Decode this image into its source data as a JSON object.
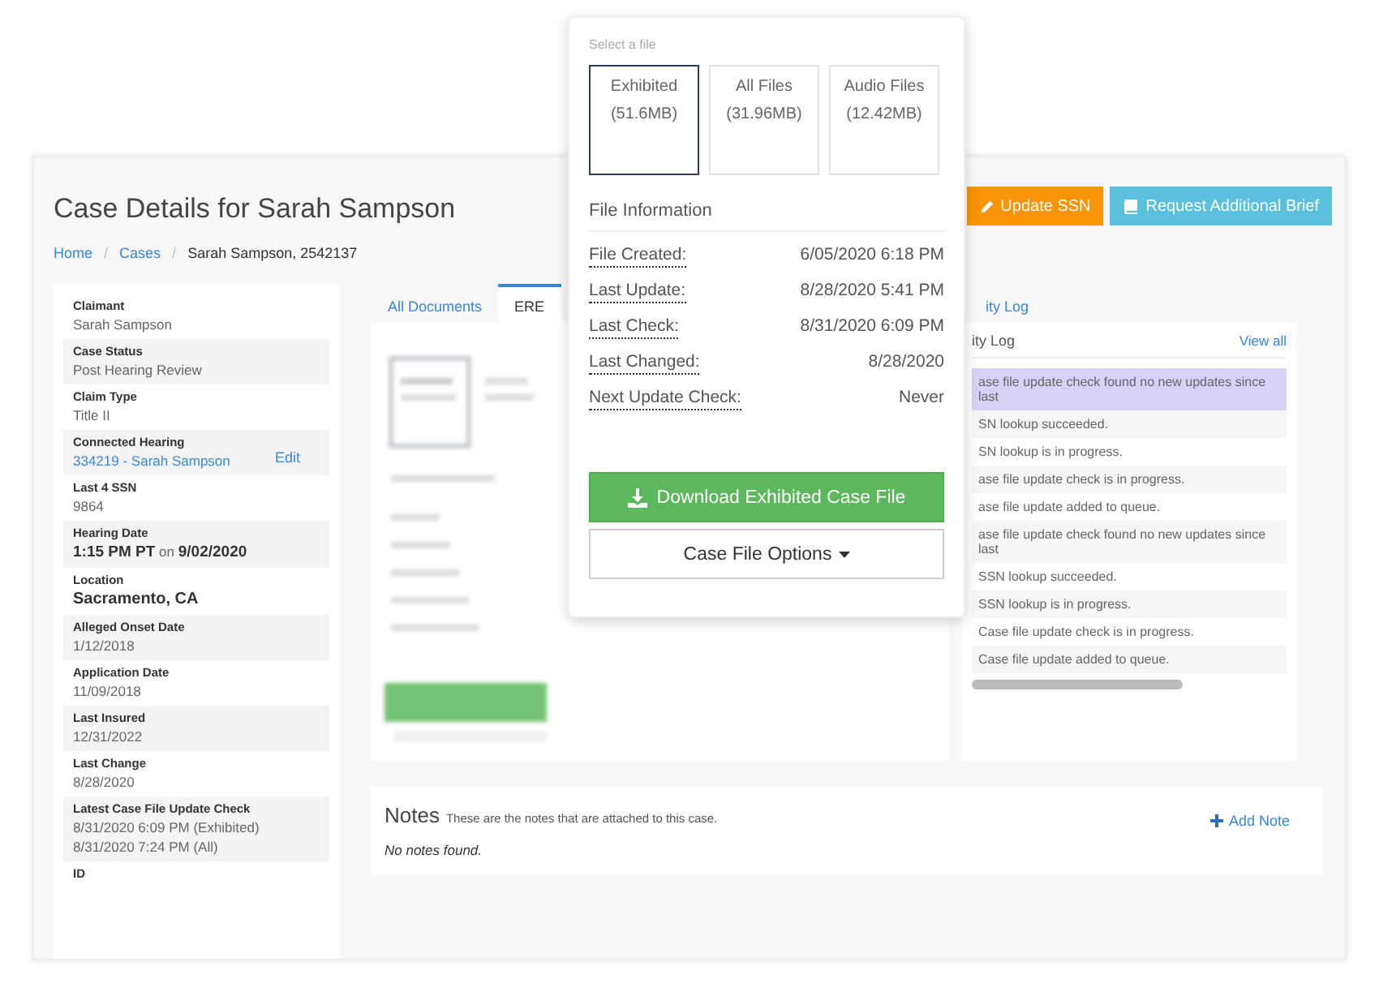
{
  "page": {
    "title": "Case Details for Sarah Sampson",
    "breadcrumb_separators": [
      "/",
      "/"
    ],
    "breadcrumbs": [
      {
        "label": "Home",
        "link": true
      },
      {
        "label": "Cases",
        "link": true
      },
      {
        "label": "Sarah Sampson, 2542137",
        "link": false
      }
    ],
    "actions": [
      {
        "label": "Update SSN",
        "kind": "warning"
      },
      {
        "label": "Request Additional Brief",
        "kind": "info"
      }
    ]
  },
  "details": [
    {
      "label": "Claimant",
      "kind": "plain",
      "values": [
        "Sarah Sampson"
      ]
    },
    {
      "label": "Case Status",
      "kind": "plain",
      "values": [
        "Post Hearing Review"
      ]
    },
    {
      "label": "Claim Type",
      "kind": "plain",
      "values": [
        "Title II"
      ]
    },
    {
      "label": "Connected Hearing",
      "kind": "link",
      "values": [
        "334219 - Sarah Sampson"
      ],
      "action": "Edit"
    },
    {
      "label": "Last 4 SSN",
      "kind": "plain",
      "values": [
        "9864"
      ]
    },
    {
      "label": "Hearing Date",
      "kind": "rich",
      "values": [
        "**1:15 PM PT** on **9/02/2020**"
      ]
    },
    {
      "label": "Location",
      "kind": "bold",
      "values": [
        "Sacramento, CA"
      ]
    },
    {
      "label": "Alleged Onset Date",
      "kind": "plain",
      "values": [
        "1/12/2018"
      ]
    },
    {
      "label": "Application Date",
      "kind": "plain",
      "values": [
        "11/09/2018"
      ]
    },
    {
      "label": "Last Insured",
      "kind": "plain",
      "values": [
        "12/31/2022"
      ]
    },
    {
      "label": "Last Change",
      "kind": "plain",
      "values": [
        "8/28/2020"
      ]
    },
    {
      "label": "Latest Case File Update Check",
      "kind": "plain",
      "values": [
        "8/31/2020 6:09 PM (Exhibited)",
        "8/31/2020 7:24 PM (All)"
      ]
    },
    {
      "label": "ID"
    }
  ],
  "tabs": [
    {
      "label": "All Documents",
      "selected": false
    },
    {
      "label": "ERE",
      "selected": true
    },
    {
      "label": "ity Log",
      "selected": false
    }
  ],
  "activity_log": {
    "title": "ity Log",
    "view_all": "View all",
    "rows": [
      {
        "text": "ase file update check found no new updates since last",
        "highlighted": true
      },
      {
        "text": "SN lookup succeeded.",
        "highlighted": false
      },
      {
        "text": "SN lookup is in progress.",
        "highlighted": false
      },
      {
        "text": "ase file update check is in progress.",
        "highlighted": false
      },
      {
        "text": "ase file update added to queue.",
        "highlighted": false
      },
      {
        "text": "ase file update check found no new updates since last",
        "highlighted": false
      },
      {
        "text": "SSN lookup succeeded.",
        "highlighted": false
      },
      {
        "text": "SSN lookup is in progress.",
        "highlighted": false
      },
      {
        "text": "Case file update check is in progress.",
        "highlighted": false
      },
      {
        "text": "Case file update added to queue.",
        "highlighted": false
      }
    ]
  },
  "notes": {
    "title": "Notes",
    "subtitle": "These are the notes that are attached to this case.",
    "add": "Add Note",
    "empty": "No notes found."
  },
  "popover": {
    "prompt": "Select a file",
    "files": [
      {
        "name": "Exhibited",
        "size": "(51.6MB)",
        "selected": true
      },
      {
        "name": "All Files",
        "size": "(31.96MB)",
        "selected": false
      },
      {
        "name": "Audio Files",
        "size": "(12.42MB)",
        "selected": false
      }
    ],
    "info_title": "File Information",
    "info": [
      {
        "label": "File Created:",
        "value": "6/05/2020 6:18 PM"
      },
      {
        "label": "Last Update:",
        "value": "8/28/2020 5:41 PM"
      },
      {
        "label": "Last Check:",
        "value": "8/31/2020 6:09 PM"
      },
      {
        "label": "Last Changed:",
        "value": "8/28/2020"
      },
      {
        "label": "Next Update Check:",
        "value": "Never"
      }
    ],
    "download": "Download Exhibited Case File",
    "options": "Case File Options"
  }
}
